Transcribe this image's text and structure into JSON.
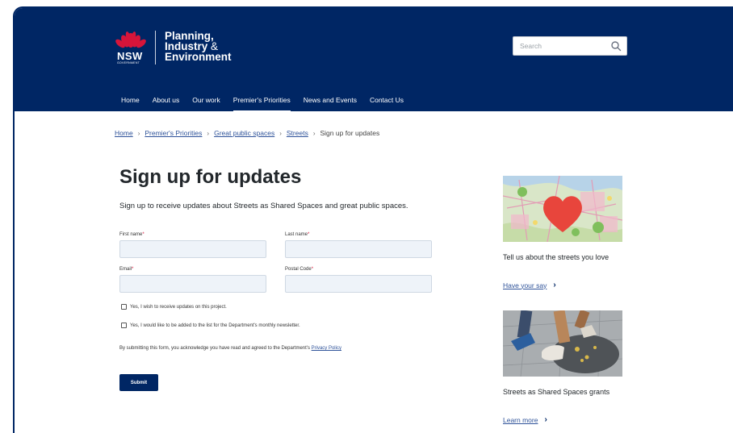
{
  "brand": {
    "nsw_text": "NSW",
    "government_text": "GOVERNMENT",
    "department_line1": "Planning,",
    "department_line2": "Industry",
    "department_amp": "&",
    "department_line3": "Environment"
  },
  "search": {
    "placeholder": "Search",
    "icon": "search-icon"
  },
  "nav": {
    "items": [
      {
        "label": "Home"
      },
      {
        "label": "About us"
      },
      {
        "label": "Our work"
      },
      {
        "label": "Premier's Priorities"
      },
      {
        "label": "News and Events"
      },
      {
        "label": "Contact Us"
      }
    ],
    "active_index": 3
  },
  "breadcrumb": {
    "items": [
      "Home",
      "Premier's Priorities",
      "Great public spaces",
      "Streets"
    ],
    "separator": "›",
    "current": "Sign up for updates"
  },
  "form": {
    "title": "Sign up for updates",
    "intro": "Sign up to receive updates about Streets as Shared Spaces and great public spaces.",
    "first_name_label": "First name",
    "last_name_label": "Last name",
    "email_label": "Email",
    "postal_label": "Postal Code",
    "required_mark": "*",
    "first_name_value": "",
    "last_name_value": "",
    "email_value": "",
    "postal_value": "",
    "checkbox1_label": "Yes, I wish to receive updates on this project.",
    "checkbox2_label": "Yes, I would like to be added to the list for the Department's monthly newsletter.",
    "consent_text": "By submitting this form, you acknowledge you have read and agreed to the Department's",
    "privacy_link": "Privacy Policy",
    "submit_label": "Submit"
  },
  "sidebar": {
    "card1": {
      "text": "Tell us about the streets you love",
      "link": "Have your say",
      "image": "map-with-heart-image"
    },
    "card2": {
      "text": "Streets as Shared Spaces grants",
      "link": "Learn more",
      "image": "street-pavement-feet-image"
    },
    "chevron": "›"
  },
  "colors": {
    "brand_navy": "#002664",
    "link_blue": "#2e5299",
    "required_red": "#d7153a",
    "input_bg": "#eef3f9",
    "heart_red": "#e8453c"
  }
}
